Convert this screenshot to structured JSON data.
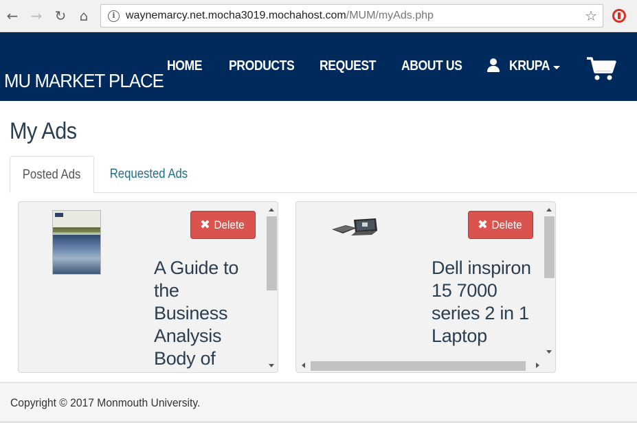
{
  "browser": {
    "url_host": "waynemarcy.net.mocha3019.mochahost.com",
    "url_path": "/MUM/myAds.php"
  },
  "navbar": {
    "brand": "MU MARKET PLACE",
    "links": [
      {
        "label": "HOME"
      },
      {
        "label": "PRODUCTS"
      },
      {
        "label": "REQUEST"
      },
      {
        "label": "ABOUT US"
      }
    ],
    "user_label": "KRUPA",
    "bg_color": "#002a5c"
  },
  "page": {
    "title": "My Ads",
    "tabs": [
      {
        "label": "Posted Ads",
        "active": true
      },
      {
        "label": "Requested Ads",
        "active": false
      }
    ]
  },
  "ads": [
    {
      "title": "A Guide to the Business Analysis Body of",
      "delete_label": "Delete",
      "image": "book-cover"
    },
    {
      "title": "Dell inspiron 15 7000 series 2 in 1 Laptop",
      "delete_label": "Delete",
      "image": "laptop"
    }
  ],
  "footer": {
    "text": "Copyright © 2017 Monmouth University."
  },
  "colors": {
    "delete": "#d9534f",
    "title": "#2b3e50",
    "tab_link": "#1e6e8e"
  }
}
